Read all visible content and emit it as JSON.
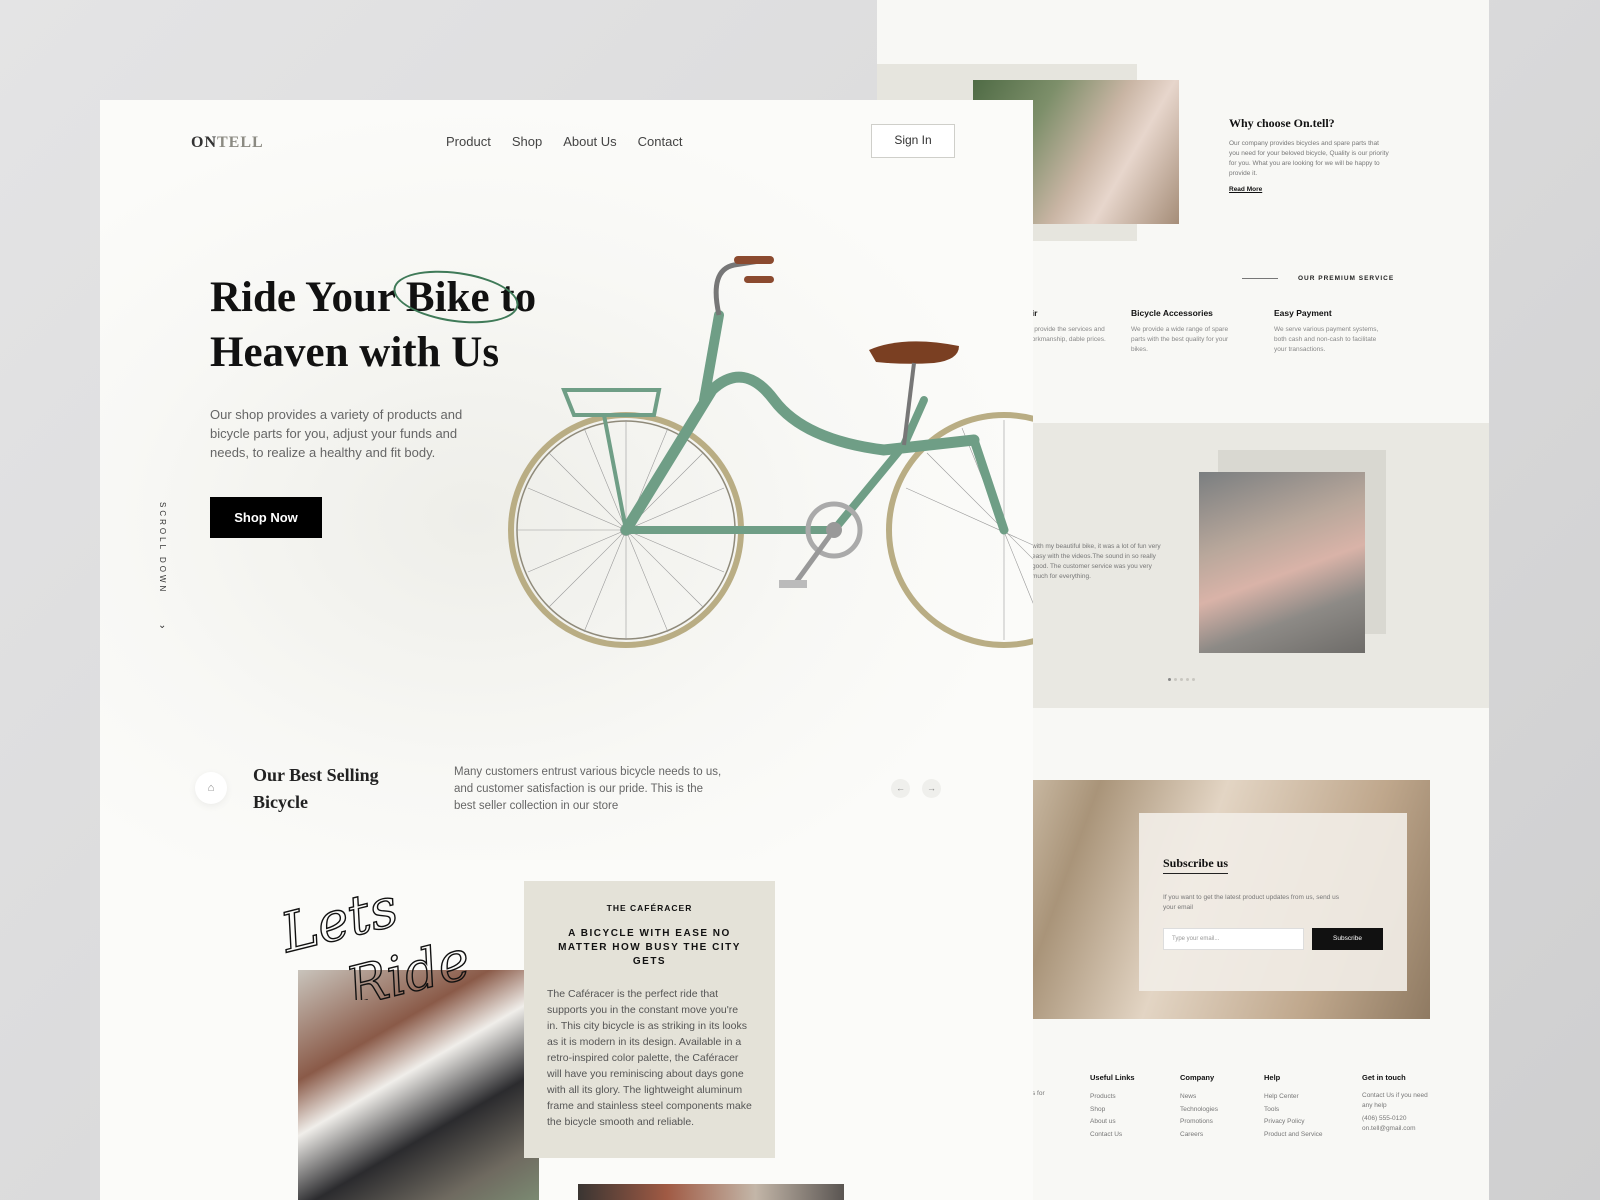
{
  "brand": {
    "logo_a": "ON",
    "logo_b": "TELL"
  },
  "nav": {
    "items": [
      "Product",
      "Shop",
      "About Us",
      "Contact"
    ],
    "signin": "Sign In"
  },
  "hero": {
    "line1": "Ride Your Bike to",
    "line2": "Heaven with Us",
    "lead": "Our shop provides a variety of products and bicycle parts for you, adjust your funds and needs, to realize a healthy and fit body.",
    "cta": "Shop Now",
    "scroll": "SCROLL DOWN",
    "accent": "#3f7a58",
    "bike_color": "#6f9e86"
  },
  "best": {
    "title": "Our Best Selling Bicycle",
    "text": "Many customers entrust various bicycle needs to us, and customer satisfaction is our pride. This is the best seller collection in our store"
  },
  "feature": {
    "script": [
      "Lets",
      "Ride"
    ],
    "kicker": "THE CAFÉRACER",
    "heading": "A BICYCLE WITH EASE NO MATTER HOW BUSY THE CITY GETS",
    "body": "The Caféracer is the perfect ride that supports you in the constant move you're in. This city bicycle is as striking in its looks as it is modern in its design. Available in a retro-inspired color palette, the Caféracer will have you reminiscing about days gone with all its glory. The lightweight aluminum frame and stainless steel components make the bicycle smooth and reliable."
  },
  "why": {
    "title": "Why choose On.tell?",
    "text": "Our company provides bicycles and spare parts that you need for your beloved bicycle, Quality is our priority for you. What you are looking for we will be happy to provide it.",
    "link": "Read More"
  },
  "premium": {
    "label": "OUR PREMIUM SERVICE",
    "services": [
      {
        "title": "air",
        "text": "to provide the services and workmanship, dable prices."
      },
      {
        "title": "Bicycle Accessories",
        "text": "We provide a wide range of spare parts with the best quality for your bikes."
      },
      {
        "title": "Easy Payment",
        "text": "We serve various payment systems, both cash and non-cash to facilitate your transactions."
      }
    ]
  },
  "testimonial": {
    "text": "with my beautiful bike, it was a lot of fun very easy with the videos.The sound in so really good. The customer service was you very much for everything."
  },
  "subscribe": {
    "title": "Subscribe us",
    "text": "If you want to get the latest product updates from us, send us your email",
    "placeholder": "Type your email...",
    "button": "Subscribe"
  },
  "footer": {
    "frag": "s for",
    "cols": [
      {
        "title": "Useful Links",
        "items": [
          "Products",
          "Shop",
          "About us",
          "Contact Us"
        ]
      },
      {
        "title": "Company",
        "items": [
          "News",
          "Technologies",
          "Promotions",
          "Careers"
        ]
      },
      {
        "title": "Help",
        "items": [
          "Help Center",
          "Tools",
          "Privacy Policy",
          "Product and Service"
        ]
      },
      {
        "title": "Get in touch",
        "items": [
          "Contact Us if you need",
          "any help",
          "(406) 555-0120",
          "on.tell@gmail.com"
        ]
      }
    ]
  }
}
